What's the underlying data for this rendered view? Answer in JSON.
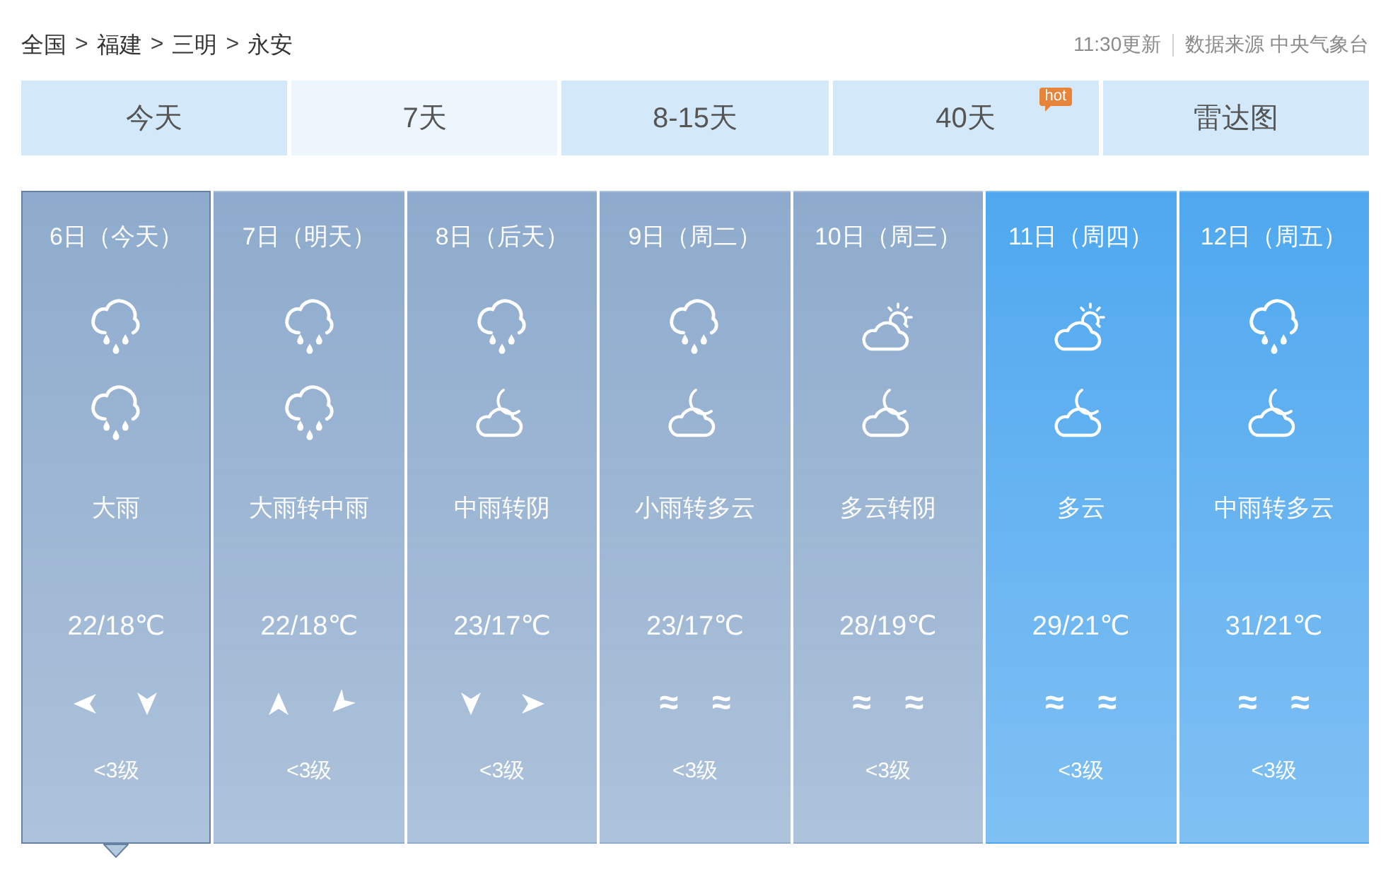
{
  "breadcrumb": {
    "items": [
      {
        "label": "全国",
        "separator": ">"
      },
      {
        "label": "福建",
        "separator": ">"
      },
      {
        "label": "三明",
        "separator": ">"
      },
      {
        "label": "永安"
      }
    ]
  },
  "update_time": "11:30更新",
  "data_source": "数据来源 中央气象台",
  "tabs": [
    {
      "label": "今天",
      "selected": false
    },
    {
      "label": "7天",
      "selected": true
    },
    {
      "label": "8-15天",
      "selected": false
    },
    {
      "label": "40天",
      "selected": false,
      "badge": "hot"
    },
    {
      "label": "雷达图",
      "selected": false
    }
  ],
  "days": [
    {
      "date": "6日（今天）",
      "selected": true,
      "color": "#8eabcd",
      "icons": [
        {
          "kind": "rain"
        },
        {
          "kind": "rain"
        }
      ],
      "weather": "大雨",
      "temperature": "22/18℃",
      "wind": [
        {
          "kind": "arrow-left"
        },
        {
          "kind": "arrow-down"
        }
      ],
      "wind_level": "<3级"
    },
    {
      "date": "7日（明天）",
      "selected": false,
      "color": "#8eabcd",
      "icons": [
        {
          "kind": "rain"
        },
        {
          "kind": "rain"
        }
      ],
      "weather": "大雨转中雨",
      "temperature": "22/18℃",
      "wind": [
        {
          "kind": "arrow-up"
        },
        {
          "kind": "arrow-downleft"
        }
      ],
      "wind_level": "<3级"
    },
    {
      "date": "8日（后天）",
      "selected": false,
      "color": "#8eabcd",
      "icons": [
        {
          "kind": "rain"
        },
        {
          "kind": "moon-cloud"
        }
      ],
      "weather": "中雨转阴",
      "temperature": "23/17℃",
      "wind": [
        {
          "kind": "arrow-down"
        },
        {
          "kind": "arrow-right"
        }
      ],
      "wind_level": "<3级"
    },
    {
      "date": "9日（周二）",
      "selected": false,
      "color": "#8eabcd",
      "icons": [
        {
          "kind": "rain"
        },
        {
          "kind": "moon-cloud"
        }
      ],
      "weather": "小雨转多云",
      "temperature": "23/17℃",
      "wind": [
        {
          "kind": "glyph",
          "text": "≈"
        },
        {
          "kind": "glyph",
          "text": "≈"
        }
      ],
      "wind_level": "<3级"
    },
    {
      "date": "10日（周三）",
      "selected": false,
      "color": "#8eabcd",
      "icons": [
        {
          "kind": "sun-cloud"
        },
        {
          "kind": "moon-cloud"
        }
      ],
      "weather": "多云转阴",
      "temperature": "28/19℃",
      "wind": [
        {
          "kind": "glyph",
          "text": "≈"
        },
        {
          "kind": "glyph",
          "text": "≈"
        }
      ],
      "wind_level": "<3级"
    },
    {
      "date": "11日（周四）",
      "selected": false,
      "color": "#4fa8ef",
      "icons": [
        {
          "kind": "sun-cloud"
        },
        {
          "kind": "moon-cloud"
        }
      ],
      "weather": "多云",
      "temperature": "29/21℃",
      "wind": [
        {
          "kind": "glyph",
          "text": "≈"
        },
        {
          "kind": "glyph",
          "text": "≈"
        }
      ],
      "wind_level": "<3级"
    },
    {
      "date": "12日（周五）",
      "selected": false,
      "color": "#4fa8ef",
      "icons": [
        {
          "kind": "rain"
        },
        {
          "kind": "moon-cloud"
        }
      ],
      "weather": "中雨转多云",
      "temperature": "31/21℃",
      "wind": [
        {
          "kind": "glyph",
          "text": "≈"
        },
        {
          "kind": "glyph",
          "text": "≈"
        }
      ],
      "wind_level": "<3级"
    }
  ]
}
